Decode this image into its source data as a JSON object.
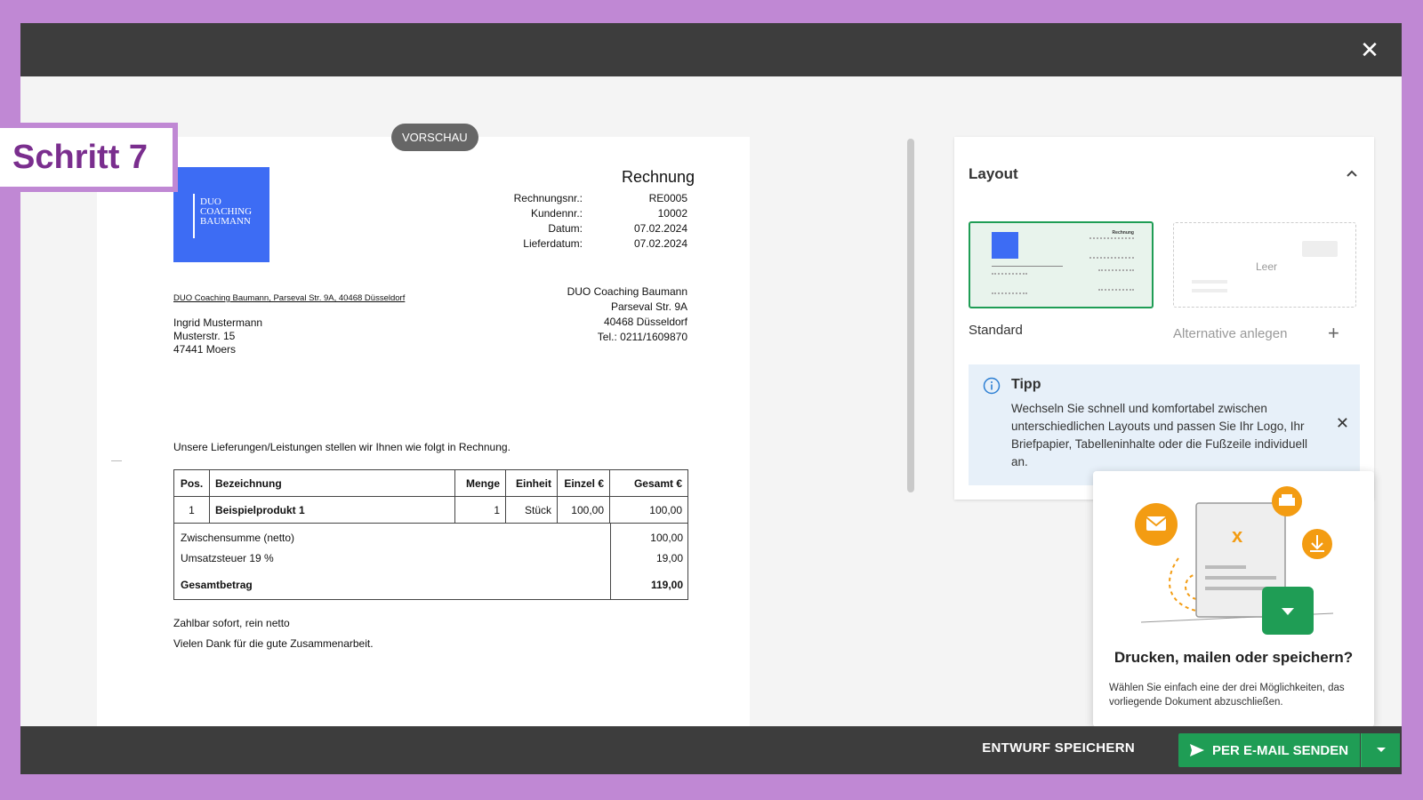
{
  "step_label": "Schritt 7",
  "preview_badge": "VORSCHAU",
  "invoice": {
    "logo_lines": [
      "DUO",
      "COACHING",
      "BAUMANN"
    ],
    "title": "Rechnung",
    "meta": [
      {
        "key": "Rechnungsnr.:",
        "value": "RE0005"
      },
      {
        "key": "Kundennr.:",
        "value": "10002"
      },
      {
        "key": "Datum:",
        "value": "07.02.2024"
      },
      {
        "key": "Lieferdatum:",
        "value": "07.02.2024"
      }
    ],
    "sender_line": "DUO Coaching Baumann, Parseval Str. 9A, 40468 Düsseldorf",
    "recipient": [
      "Ingrid Mustermann",
      "Musterstr. 15",
      "47441 Moers"
    ],
    "company": [
      "DUO Coaching Baumann",
      "Parseval Str. 9A",
      "40468 Düsseldorf",
      "Tel.: 0211/1609870"
    ],
    "intro": "Unsere Lieferungen/Leistungen stellen wir Ihnen wie folgt in Rechnung.",
    "table": {
      "headers": [
        "Pos.",
        "Bezeichnung",
        "Menge",
        "Einheit",
        "Einzel €",
        "Gesamt €"
      ],
      "rows": [
        [
          "1",
          "Beispielprodukt 1",
          "1",
          "Stück",
          "100,00",
          "100,00"
        ]
      ]
    },
    "totals": [
      {
        "label": "Zwischensumme (netto)",
        "value": "100,00"
      },
      {
        "label": "Umsatzsteuer 19 %",
        "value": "19,00"
      },
      {
        "label": "Gesamtbetrag",
        "value": "119,00"
      }
    ],
    "footer": [
      "Zahlbar sofort, rein netto",
      "Vielen Dank für die gute Zusammenarbeit."
    ]
  },
  "layout_panel": {
    "title": "Layout",
    "standard_label": "Standard",
    "empty_label": "Leer",
    "alternative_label": "Alternative anlegen",
    "thumb_title": "Rechnung"
  },
  "tip": {
    "title": "Tipp",
    "text": "Wechseln Sie schnell und komfortabel zwischen unterschiedlichen Layouts und passen Sie Ihr Logo, Ihr Briefpapier, Tabelleninhalte oder die Fußzeile individuell an."
  },
  "popup": {
    "title": "Drucken, mailen oder speichern?",
    "text": "Wählen Sie einfach eine der drei Möglichkeiten, das vorliegende Dokument abzuschließen."
  },
  "bottombar": {
    "draft_label": "ENTWURF SPEICHERN",
    "send_label": "PER E-MAIL SENDEN"
  },
  "colors": {
    "accent_green": "#1f9d55",
    "logo_blue": "#3d6cf4",
    "frame_purple": "#c088d4",
    "icon_orange": "#f39c12"
  }
}
